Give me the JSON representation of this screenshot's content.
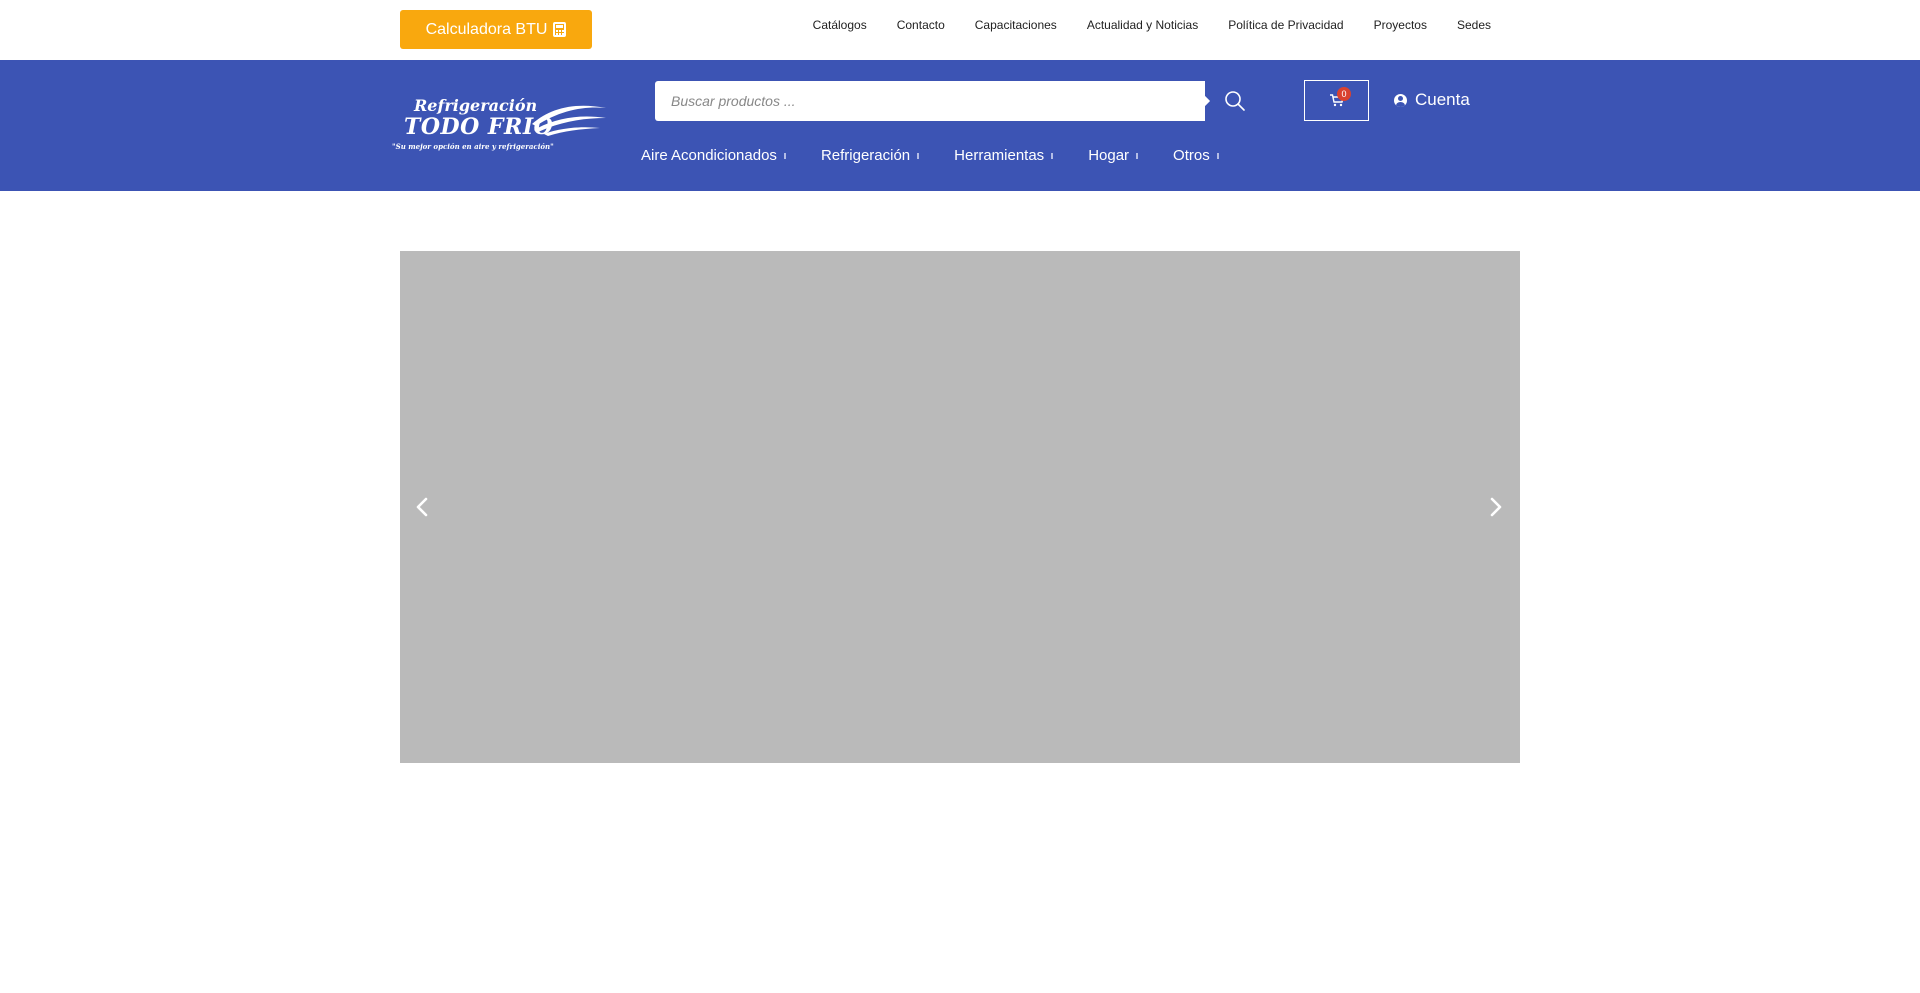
{
  "topbar": {
    "btu_button_label": "Calculadora BTU",
    "btu_icon": "calculator-icon",
    "links": [
      "Catálogos",
      "Contacto",
      "Capacitaciones",
      "Actualidad y Noticias",
      "Política de Privacidad",
      "Proyectos",
      "Sedes"
    ]
  },
  "header": {
    "logo": {
      "line1": "Refrigeración",
      "line2": "TODO FRIO",
      "tagline": "\"Su mejor opción en aire y refrigeración\""
    },
    "search": {
      "placeholder": "Buscar productos ...",
      "icon": "search-icon"
    },
    "cart": {
      "count": "0",
      "icon": "cart-icon"
    },
    "account": {
      "label": "Cuenta",
      "icon": "user-circle-icon"
    },
    "categories": [
      "Aire Acondicionados",
      "Refrigeración",
      "Herramientas",
      "Hogar",
      "Otros"
    ]
  },
  "slider": {
    "prev_icon": "chevron-left-icon",
    "next_icon": "chevron-right-icon"
  },
  "colors": {
    "header_bg": "#3c54b4",
    "btu_button": "#f9a80e",
    "slider_placeholder": "#bababa",
    "cart_badge": "#d9412f"
  }
}
